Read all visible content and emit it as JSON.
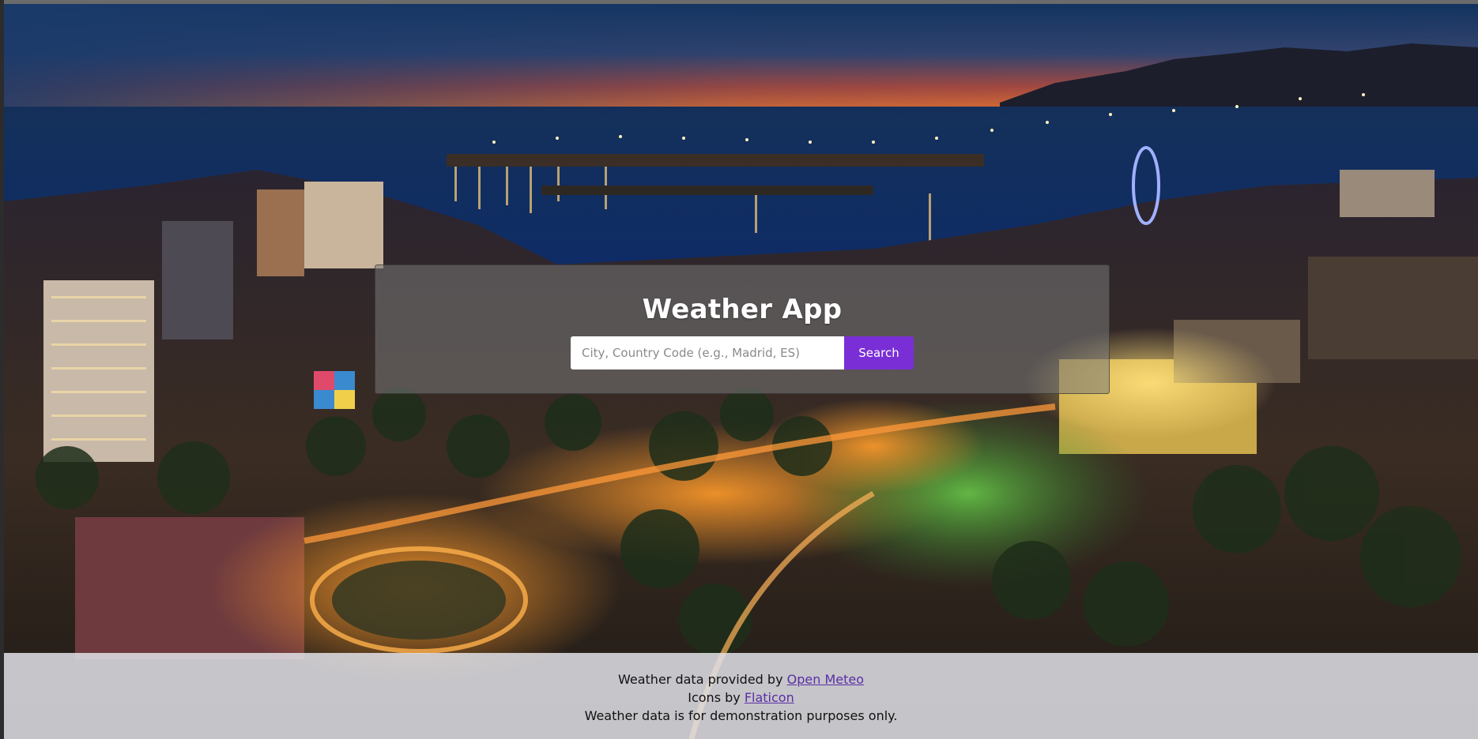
{
  "app": {
    "title": "Weather App"
  },
  "search": {
    "placeholder": "City, Country Code (e.g., Madrid, ES)",
    "value": "",
    "button_label": "Search"
  },
  "footer": {
    "line1_prefix": "Weather data provided by ",
    "line1_link": "Open Meteo",
    "line2_prefix": "Icons by ",
    "line2_link": "Flaticon",
    "line3": "Weather data is for demonstration purposes only."
  },
  "colors": {
    "accent": "#7a2fd6",
    "link": "#5a2ea6"
  }
}
